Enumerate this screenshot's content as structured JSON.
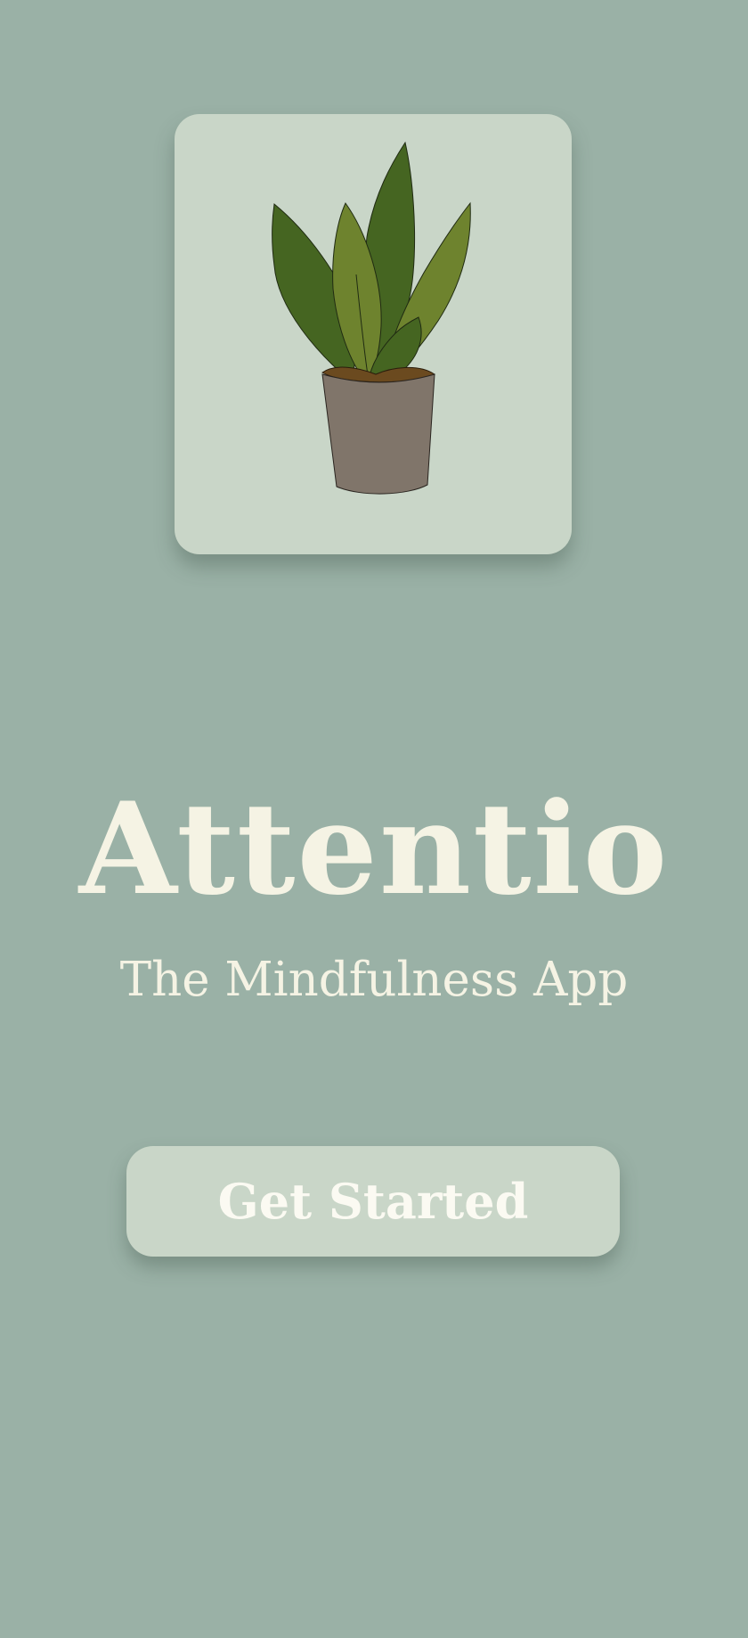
{
  "app": {
    "title": "Attentio",
    "subtitle": "The Mindfulness App"
  },
  "actions": {
    "get_started_label": "Get Started"
  },
  "logo": {
    "icon": "potted-plant-icon"
  },
  "colors": {
    "background": "#9ab1a6",
    "card": "#c9d6c8",
    "text": "#f5f3e4",
    "leaf_dark": "#456521",
    "leaf_light": "#6e832e",
    "pot": "#80756a",
    "soil": "#6b4a1f"
  }
}
